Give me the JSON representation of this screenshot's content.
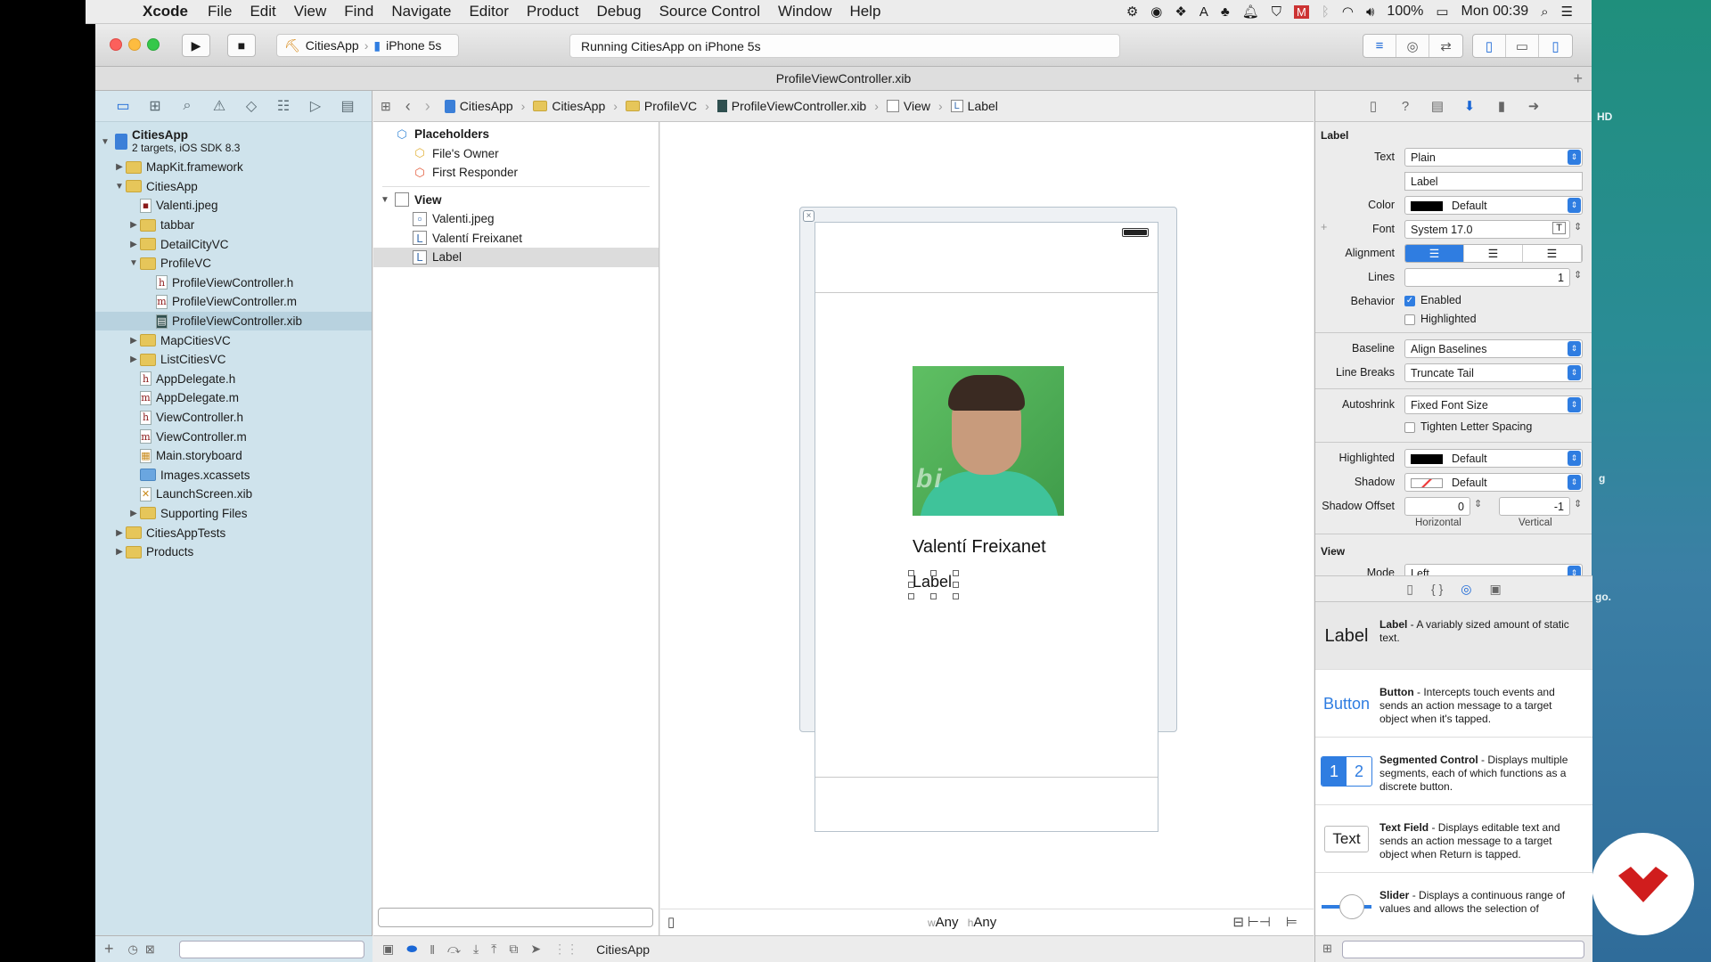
{
  "menubar": {
    "app": "Xcode",
    "items": [
      "File",
      "Edit",
      "View",
      "Find",
      "Navigate",
      "Editor",
      "Product",
      "Debug",
      "Source Control",
      "Window",
      "Help"
    ],
    "battery": "100%",
    "clock": "Mon 00:39"
  },
  "toolbar": {
    "scheme_app": "CitiesApp",
    "scheme_device": "iPhone 5s",
    "activity": "Running CitiesApp on iPhone 5s"
  },
  "tab": {
    "title": "ProfileViewController.xib"
  },
  "navigator": {
    "root_name": "CitiesApp",
    "root_sub": "2 targets, iOS SDK 8.3",
    "items": [
      {
        "label": "MapKit.framework"
      },
      {
        "label": "CitiesApp"
      },
      {
        "label": "Valenti.jpeg"
      },
      {
        "label": "tabbar"
      },
      {
        "label": "DetailCityVC"
      },
      {
        "label": "ProfileVC"
      },
      {
        "label": "ProfileViewController.h"
      },
      {
        "label": "ProfileViewController.m"
      },
      {
        "label": "ProfileViewController.xib"
      },
      {
        "label": "MapCitiesVC"
      },
      {
        "label": "ListCitiesVC"
      },
      {
        "label": "AppDelegate.h"
      },
      {
        "label": "AppDelegate.m"
      },
      {
        "label": "ViewController.h"
      },
      {
        "label": "ViewController.m"
      },
      {
        "label": "Main.storyboard"
      },
      {
        "label": "Images.xcassets"
      },
      {
        "label": "LaunchScreen.xib"
      },
      {
        "label": "Supporting Files"
      },
      {
        "label": "CitiesAppTests"
      },
      {
        "label": "Products"
      }
    ]
  },
  "jumpbar": {
    "crumbs": [
      "CitiesApp",
      "CitiesApp",
      "ProfileVC",
      "ProfileViewController.xib",
      "View",
      "Label"
    ]
  },
  "outline": {
    "placeholders": "Placeholders",
    "files_owner": "File's Owner",
    "first_responder": "First Responder",
    "view": "View",
    "children": [
      "Valenti.jpeg",
      "Valentí Freixanet",
      "Label"
    ]
  },
  "canvas": {
    "name_label": "Valentí Freixanet",
    "label_text": "Label",
    "size_w_prefix": "w",
    "size_w": "Any",
    "size_h_prefix": "h",
    "size_h": "Any",
    "photo_brand": "bi"
  },
  "bottombar": {
    "target": "CitiesApp"
  },
  "inspector": {
    "section_label": "Label",
    "text_k": "Text",
    "text_v": "Plain",
    "text_field": "Label",
    "color_k": "Color",
    "color_v": "Default",
    "font_k": "Font",
    "font_v": "System 17.0",
    "alignment_k": "Alignment",
    "lines_k": "Lines",
    "lines_v": "1",
    "behavior_k": "Behavior",
    "enabled": "Enabled",
    "highlighted": "Highlighted",
    "baseline_k": "Baseline",
    "baseline_v": "Align Baselines",
    "linebreaks_k": "Line Breaks",
    "linebreaks_v": "Truncate Tail",
    "autoshrink_k": "Autoshrink",
    "autoshrink_v": "Fixed Font Size",
    "tighten": "Tighten Letter Spacing",
    "hl_k": "Highlighted",
    "hl_v": "Default",
    "shadow_k": "Shadow",
    "shadow_v": "Default",
    "shadowoff_k": "Shadow Offset",
    "shadow_h": "0",
    "shadow_v2": "-1",
    "horizontal": "Horizontal",
    "vertical": "Vertical",
    "section_view": "View",
    "mode_k": "Mode",
    "mode_v": "Left"
  },
  "library": [
    {
      "icon": "Label",
      "title": "Label",
      "desc": " - A variably sized amount of static text."
    },
    {
      "icon": "Button",
      "title": "Button",
      "desc": " - Intercepts touch events and sends an action message to a target object when it's tapped."
    },
    {
      "icon": "",
      "title": "Segmented Control",
      "desc": " - Displays multiple segments, each of which functions as a discrete button."
    },
    {
      "icon": "Text",
      "title": "Text Field",
      "desc": " - Displays editable text and sends an action message to a target object when Return is tapped."
    },
    {
      "icon": "",
      "title": "Slider",
      "desc": " - Displays a continuous range of values and allows the selection of"
    }
  ],
  "library_seg": [
    "1",
    "2"
  ],
  "wallpaper": {
    "hd": "HD",
    "g": "g",
    "go": "go."
  }
}
